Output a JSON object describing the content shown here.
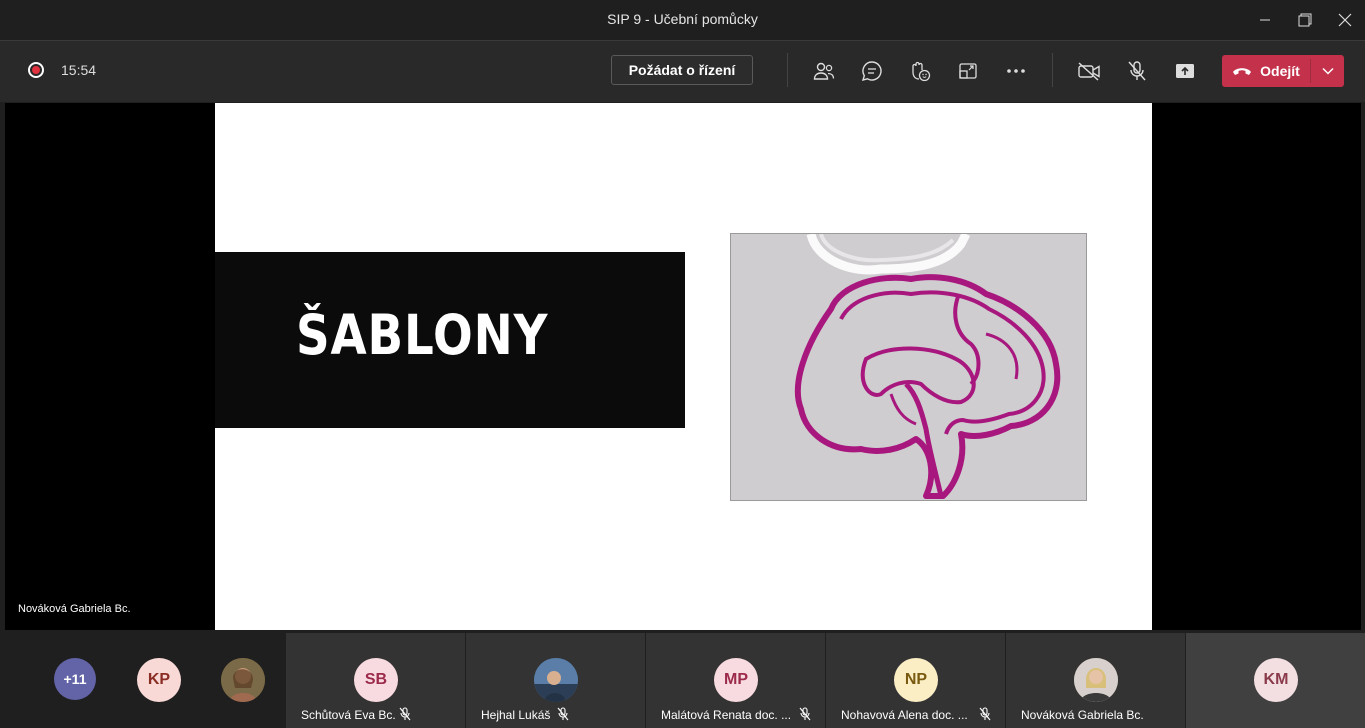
{
  "window": {
    "title": "SIP 9 - Učební pomůcky"
  },
  "toolbar": {
    "timer": "15:54",
    "request_control_label": "Požádat o řízení",
    "leave_label": "Odejít",
    "icons": [
      "participants-icon",
      "chat-icon",
      "reactions-icon",
      "rooms-icon",
      "more-icon",
      "camera-off-icon",
      "mic-off-icon",
      "share-icon"
    ]
  },
  "slide": {
    "title": "ŠABLONY"
  },
  "stage": {
    "speaker_name": "Nováková Gabriela Bc."
  },
  "participants": {
    "overflow_count": "+11",
    "small_avatars": [
      {
        "initials": "KP"
      },
      {
        "initials": ""
      }
    ],
    "tiles": [
      {
        "initials": "SB",
        "name": "Schůtová Eva Bc.",
        "muted": true
      },
      {
        "initials": "",
        "name": "Hejhal Lukáš",
        "muted": true
      },
      {
        "initials": "MP",
        "name": "Malátová Renata doc. ...",
        "muted": true
      },
      {
        "initials": "NP",
        "name": "Nohavová Alena doc. ...",
        "muted": true
      },
      {
        "initials": "",
        "name": "Nováková Gabriela Bc.",
        "muted": false
      },
      {
        "initials": "KM",
        "name": "",
        "muted": false
      }
    ]
  },
  "colors": {
    "accent_leave": "#c4314b",
    "overflow_avatar": "#6264a7",
    "recording": "#e0323f"
  }
}
